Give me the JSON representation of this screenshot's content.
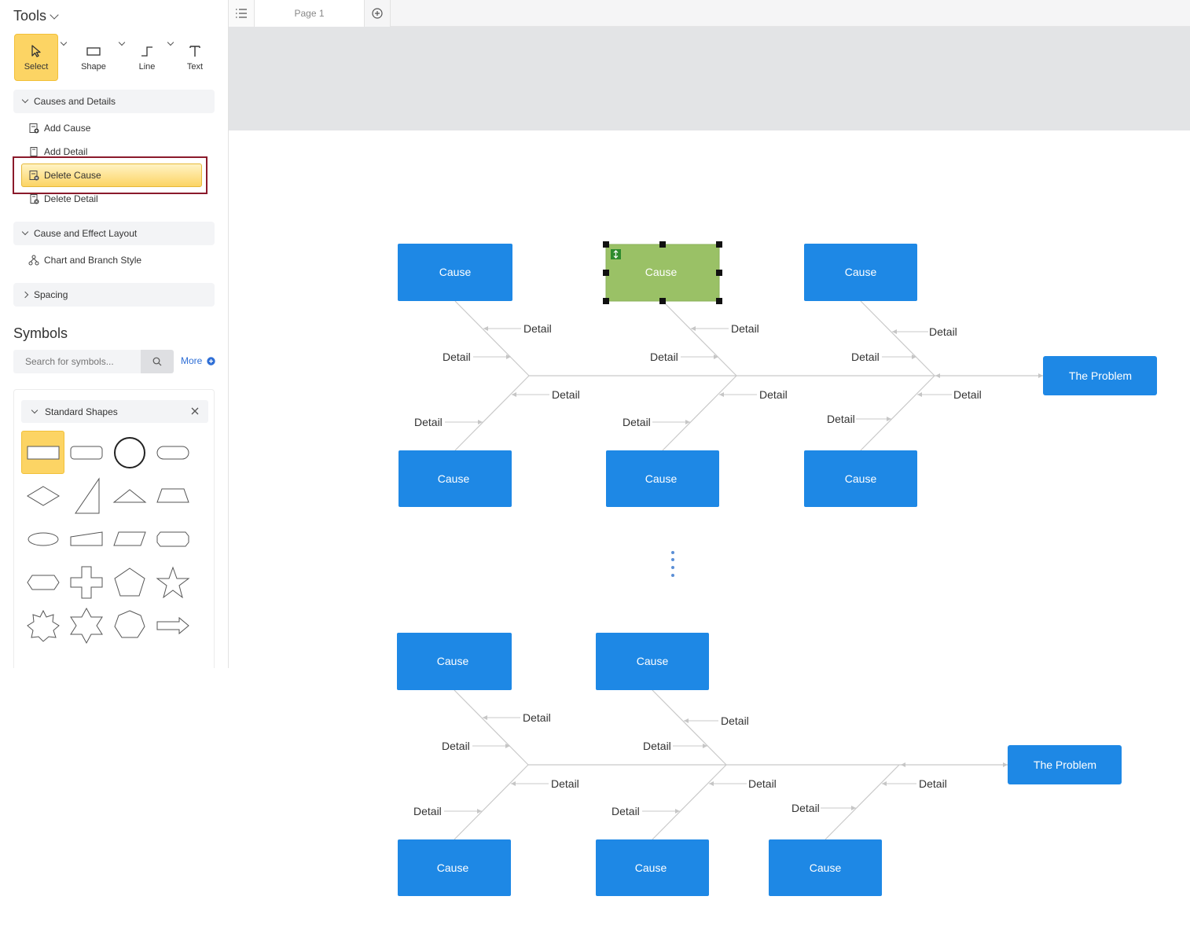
{
  "sidebar": {
    "tools_title": "Tools",
    "tools": [
      {
        "label": "Select",
        "icon": "cursor-icon",
        "active": true
      },
      {
        "label": "Shape",
        "icon": "rectangle-icon"
      },
      {
        "label": "Line",
        "icon": "connector-line-icon"
      },
      {
        "label": "Text",
        "icon": "text-icon"
      }
    ],
    "causes_section": "Causes and Details",
    "causes_items": [
      "Add Cause",
      "Add Detail",
      "Delete Cause",
      "Delete Detail"
    ],
    "layout_section": "Cause and Effect Layout",
    "layout_items": [
      "Chart and Branch Style"
    ],
    "spacing_section": "Spacing",
    "symbols_title": "Symbols",
    "search_placeholder": "Search for symbols...",
    "more_label": "More",
    "shapes_title": "Standard Shapes"
  },
  "topbar": {
    "page_tab": "Page 1"
  },
  "diagram": {
    "problem_label": "The Problem",
    "cause_label": "Cause",
    "detail_label": "Detail",
    "colors": {
      "cause": "#1e88e5",
      "selected": "#9ac166",
      "spine": "#c9c9c9"
    },
    "top_chart": {
      "problem": "The Problem",
      "causes_top": [
        "Cause",
        "Cause",
        "Cause"
      ],
      "causes_bottom": [
        "Cause",
        "Cause",
        "Cause"
      ],
      "selected_cause_index": 1
    },
    "bottom_chart": {
      "problem": "The Problem",
      "causes_top": [
        "Cause",
        "Cause"
      ],
      "causes_bottom": [
        "Cause",
        "Cause",
        "Cause"
      ]
    }
  }
}
